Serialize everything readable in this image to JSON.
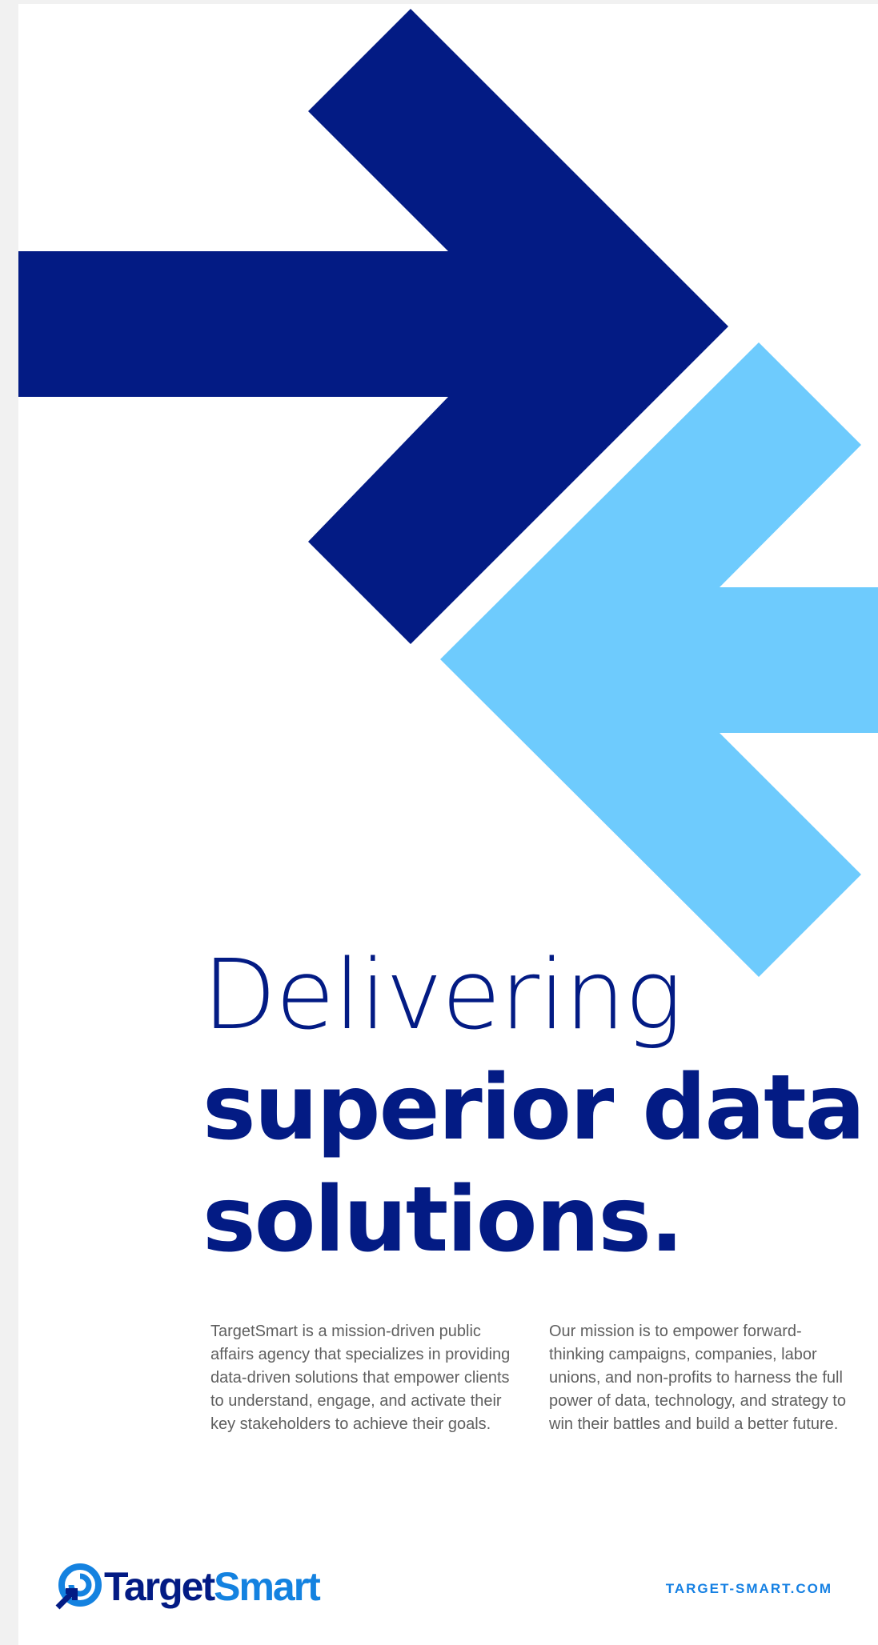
{
  "headline": {
    "line1": "Delivering",
    "line2": "superior data",
    "line3": "solutions."
  },
  "body": {
    "col1": "TargetSmart is a mission-driven public affairs agency that specializes in providing data-driven solutions that empower clients to understand, engage, and activate their key stakeholders to achieve their goals.",
    "col2": "Our mission is to empower forward-thinking campaigns, companies, labor unions, and non-profits to harness the full power of data, technology, and strategy to win their battles and build a better future."
  },
  "footer": {
    "logo_part1": "Target",
    "logo_part2": "Smart",
    "url": "TARGET-SMART.COM"
  },
  "colors": {
    "navy": "#031b84",
    "light_blue": "#6ecbfd",
    "logo_blue": "#1482e0",
    "body_text": "#5f5f5f",
    "background": "#ffffff"
  },
  "icons": {
    "arrow_right": "arrow-right-icon",
    "arrow_left": "arrow-left-icon",
    "logo_mark": "target-logo-icon"
  }
}
